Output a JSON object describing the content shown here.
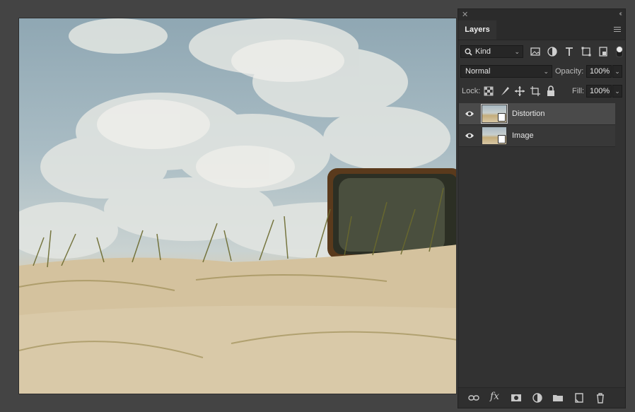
{
  "canvas": {
    "image_description_icon": "photo-canvas"
  },
  "panel": {
    "tab_label": "Layers",
    "kind_filter": "Kind",
    "blend_mode": "Normal",
    "opacity_label": "Opacity:",
    "opacity_value": "100%",
    "lock_label": "Lock:",
    "fill_label": "Fill:",
    "fill_value": "100%",
    "layers": [
      {
        "name": "Distortion",
        "selected": true,
        "visible": true
      },
      {
        "name": "Image",
        "selected": false,
        "visible": true
      }
    ],
    "filter_icons": [
      "image-filter-icon",
      "adjustment-filter-icon",
      "type-filter-icon",
      "shape-filter-icon",
      "smart-object-filter-icon"
    ],
    "lock_icons": [
      "lock-transparent-icon",
      "lock-pixels-icon",
      "lock-position-icon",
      "lock-artboard-icon",
      "lock-all-icon"
    ],
    "footer_icons": [
      "link-layers-icon",
      "fx-icon",
      "add-mask-icon",
      "adjustment-layer-icon",
      "group-folder-icon",
      "new-layer-icon",
      "trash-icon"
    ],
    "fx_label": "fx"
  },
  "colors": {
    "panel_bg": "#323232",
    "selected_layer": "#4a4a4a",
    "workspace": "#444444"
  }
}
